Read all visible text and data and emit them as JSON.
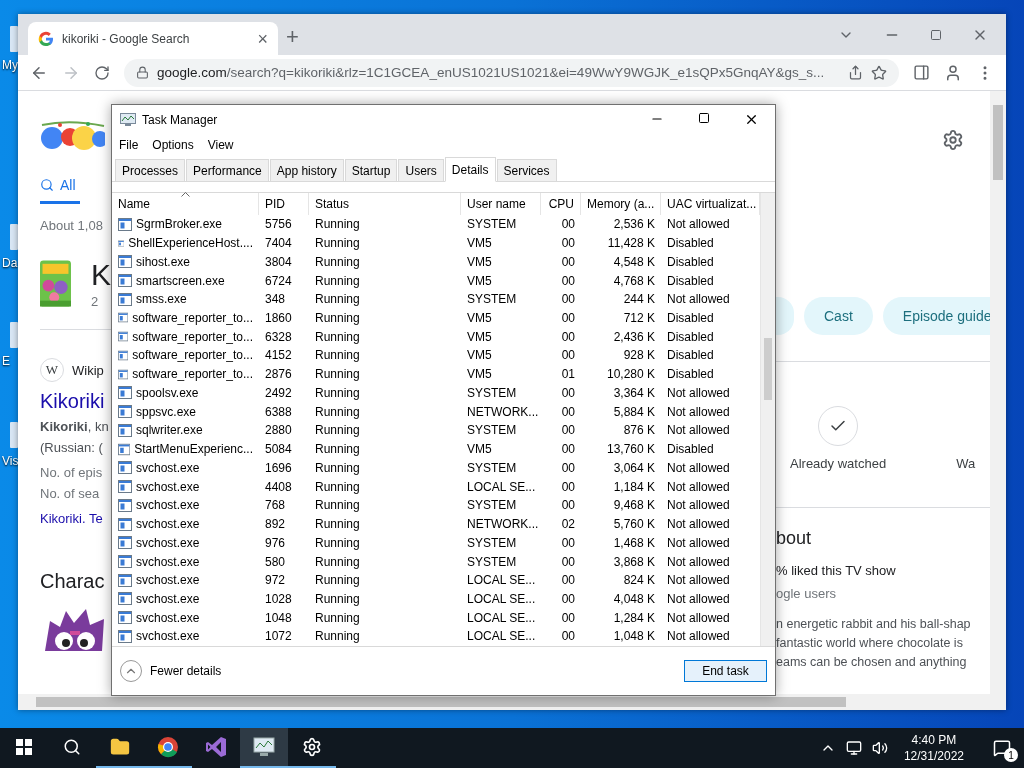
{
  "desktop": {
    "icons": [
      {
        "label": "My"
      },
      {
        "label": "Da"
      },
      {
        "label": "E"
      },
      {
        "label": "Vis"
      }
    ]
  },
  "browser": {
    "tab": {
      "title": "kikoriki - Google Search",
      "close": "×"
    },
    "new_tab": "+",
    "url": {
      "host": "google.com",
      "path": "/search?q=kikoriki&rlz=1C1GCEA_enUS1021US1021&ei=49WwY9WGJK_e1sQPx5GnqAY&gs_s..."
    },
    "page": {
      "left": {
        "tabs": [
          {
            "label": "All",
            "selected": true
          }
        ],
        "result_count": "About 1,08",
        "title": "K",
        "subtitle": "2",
        "source_icon": "W",
        "source": "Wikip",
        "link": "Kikoriki",
        "snippet": "**Kikoriki**, kn",
        "snippet_2": "(Russian: (",
        "facts": [
          "No. of epis",
          "No. of sea"
        ],
        "more_link": "Kikoriki. Te",
        "section": "Charac"
      },
      "right": {
        "chips": [
          "Cast",
          "Episode guide"
        ],
        "watched": "Already watched",
        "next_action": "Wa",
        "about": "bout",
        "likes": "% liked this TV show",
        "likes_source": "ogle users",
        "description": [
          "n energetic rabbit and his ball-shap",
          "fantastic world where chocolate is",
          "eams can be chosen and anything"
        ]
      }
    }
  },
  "task_manager": {
    "title": "Task Manager",
    "menu": [
      "File",
      "Options",
      "View"
    ],
    "tabs": [
      {
        "label": "Processes",
        "selected": false
      },
      {
        "label": "Performance",
        "selected": false
      },
      {
        "label": "App history",
        "selected": false
      },
      {
        "label": "Startup",
        "selected": false
      },
      {
        "label": "Users",
        "selected": false
      },
      {
        "label": "Details",
        "selected": true
      },
      {
        "label": "Services",
        "selected": false
      }
    ],
    "columns": [
      {
        "label": "Name",
        "sorted": true
      },
      {
        "label": "PID",
        "sorted": false
      },
      {
        "label": "Status",
        "sorted": false
      },
      {
        "label": "User name",
        "sorted": false
      },
      {
        "label": "CPU",
        "sorted": false
      },
      {
        "label": "Memory (a...",
        "sorted": false
      },
      {
        "label": "UAC virtualizat...",
        "sorted": false
      }
    ],
    "rows": [
      [
        "SgrmBroker.exe",
        "5756",
        "Running",
        "SYSTEM",
        "00",
        "2,536 K",
        "Not allowed"
      ],
      [
        "ShellExperienceHost....",
        "7404",
        "Running",
        "VM5",
        "00",
        "11,428 K",
        "Disabled"
      ],
      [
        "sihost.exe",
        "3804",
        "Running",
        "VM5",
        "00",
        "4,548 K",
        "Disabled"
      ],
      [
        "smartscreen.exe",
        "6724",
        "Running",
        "VM5",
        "00",
        "4,768 K",
        "Disabled"
      ],
      [
        "smss.exe",
        "348",
        "Running",
        "SYSTEM",
        "00",
        "244 K",
        "Not allowed"
      ],
      [
        "software_reporter_to...",
        "1860",
        "Running",
        "VM5",
        "00",
        "712 K",
        "Disabled"
      ],
      [
        "software_reporter_to...",
        "6328",
        "Running",
        "VM5",
        "00",
        "2,436 K",
        "Disabled"
      ],
      [
        "software_reporter_to...",
        "4152",
        "Running",
        "VM5",
        "00",
        "928 K",
        "Disabled"
      ],
      [
        "software_reporter_to...",
        "2876",
        "Running",
        "VM5",
        "01",
        "10,280 K",
        "Disabled"
      ],
      [
        "spoolsv.exe",
        "2492",
        "Running",
        "SYSTEM",
        "00",
        "3,364 K",
        "Not allowed"
      ],
      [
        "sppsvc.exe",
        "6388",
        "Running",
        "NETWORK...",
        "00",
        "5,884 K",
        "Not allowed"
      ],
      [
        "sqlwriter.exe",
        "2880",
        "Running",
        "SYSTEM",
        "00",
        "876 K",
        "Not allowed"
      ],
      [
        "StartMenuExperienc...",
        "5084",
        "Running",
        "VM5",
        "00",
        "13,760 K",
        "Disabled"
      ],
      [
        "svchost.exe",
        "1696",
        "Running",
        "SYSTEM",
        "00",
        "3,064 K",
        "Not allowed"
      ],
      [
        "svchost.exe",
        "4408",
        "Running",
        "LOCAL SE...",
        "00",
        "1,184 K",
        "Not allowed"
      ],
      [
        "svchost.exe",
        "768",
        "Running",
        "SYSTEM",
        "00",
        "9,468 K",
        "Not allowed"
      ],
      [
        "svchost.exe",
        "892",
        "Running",
        "NETWORK...",
        "02",
        "5,760 K",
        "Not allowed"
      ],
      [
        "svchost.exe",
        "976",
        "Running",
        "SYSTEM",
        "00",
        "1,468 K",
        "Not allowed"
      ],
      [
        "svchost.exe",
        "580",
        "Running",
        "SYSTEM",
        "00",
        "3,868 K",
        "Not allowed"
      ],
      [
        "svchost.exe",
        "972",
        "Running",
        "LOCAL SE...",
        "00",
        "824 K",
        "Not allowed"
      ],
      [
        "svchost.exe",
        "1028",
        "Running",
        "LOCAL SE...",
        "00",
        "4,048 K",
        "Not allowed"
      ],
      [
        "svchost.exe",
        "1048",
        "Running",
        "LOCAL SE...",
        "00",
        "1,284 K",
        "Not allowed"
      ],
      [
        "svchost.exe",
        "1072",
        "Running",
        "LOCAL SE...",
        "00",
        "1,048 K",
        "Not allowed"
      ]
    ],
    "fewer_details": "Fewer details",
    "end_task": "End task"
  },
  "taskbar": {
    "time": "4:40 PM",
    "date": "12/31/2022",
    "notifications": "1"
  }
}
